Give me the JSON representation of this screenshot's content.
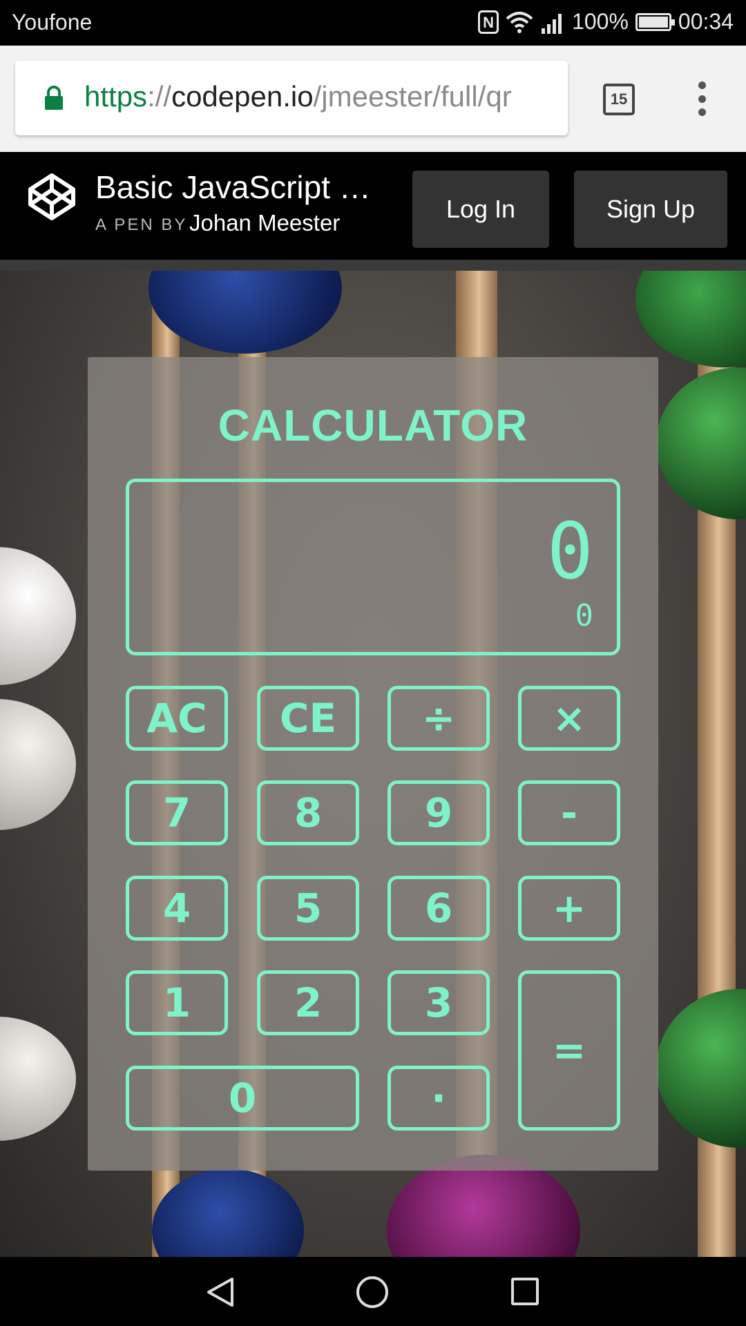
{
  "status_bar": {
    "carrier": "Youfone",
    "nfc_label": "N",
    "battery": "100%",
    "time": "00:34"
  },
  "browser": {
    "url_scheme": "https",
    "url_sep": "://",
    "url_host": "codepen.io",
    "url_path": "/jmeester/full/qr",
    "tab_count": "15"
  },
  "codepen_header": {
    "title": "Basic JavaScript …",
    "byline": "A PEN BY",
    "author": "Johan Meester",
    "login_label": "Log In",
    "signup_label": "Sign Up"
  },
  "calculator": {
    "title": "CALCULATOR",
    "display_main": "0",
    "display_sub": "0",
    "keys": {
      "ac": "AC",
      "ce": "CE",
      "divide": "÷",
      "multiply": "×",
      "seven": "7",
      "eight": "8",
      "nine": "9",
      "minus": "-",
      "four": "4",
      "five": "5",
      "six": "6",
      "plus": "+",
      "one": "1",
      "two": "2",
      "three": "3",
      "equals": "=",
      "zero": "0",
      "decimal": "·"
    }
  },
  "colors": {
    "accent": "#7ef2c8",
    "https_green": "#0b8043"
  },
  "icons": [
    "lock-icon",
    "tabs-icon",
    "menu-icon",
    "codepen-logo-icon",
    "wifi-icon",
    "signal-icon",
    "battery-icon",
    "nfc-icon",
    "back-icon",
    "home-icon",
    "recents-icon"
  ]
}
